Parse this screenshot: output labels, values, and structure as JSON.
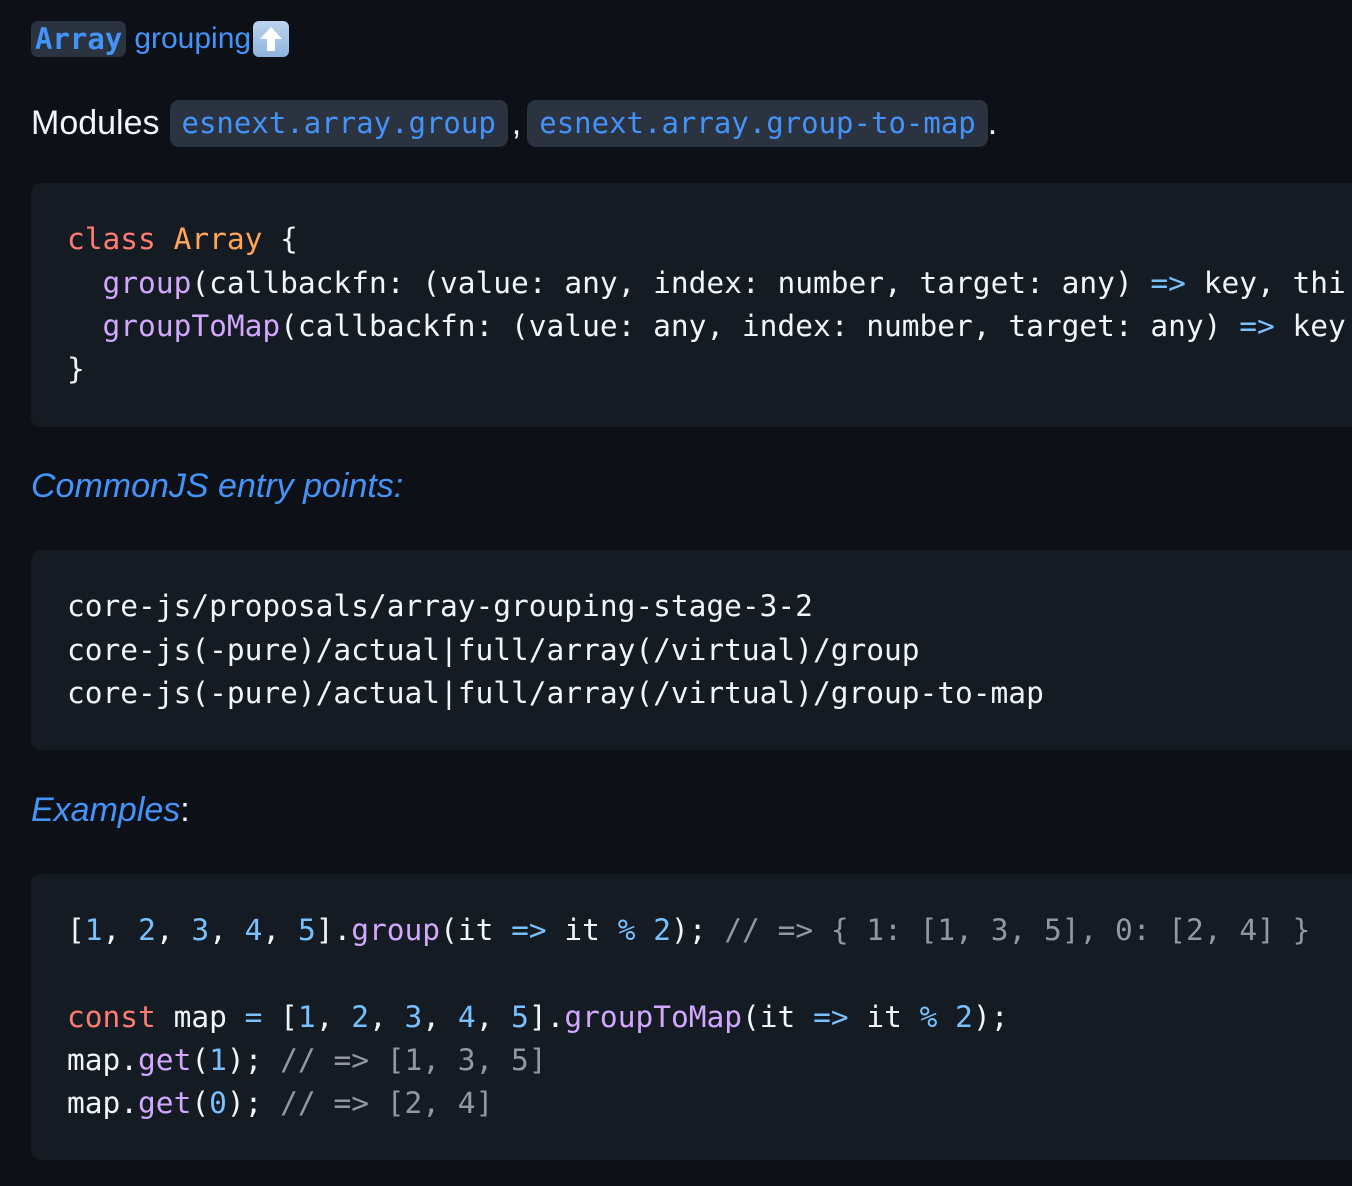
{
  "heading": {
    "code": "Array",
    "text": "grouping",
    "icon": "up-arrow-emoji-icon"
  },
  "modules": {
    "prefix": "Modules",
    "items": [
      "esnext.array.group",
      "esnext.array.group-to-map"
    ],
    "separator": ",",
    "suffix": "."
  },
  "type_def": {
    "lines": [
      [
        {
          "t": "class",
          "c": "kw"
        },
        {
          "t": " ",
          "c": ""
        },
        {
          "t": "Array",
          "c": "cls"
        },
        {
          "t": " {",
          "c": ""
        }
      ],
      [
        {
          "t": "  ",
          "c": ""
        },
        {
          "t": "group",
          "c": "fn"
        },
        {
          "t": "(callbackfn: (value: any, index: number, target: any) ",
          "c": ""
        },
        {
          "t": "=>",
          "c": "op"
        },
        {
          "t": " key, thi",
          "c": ""
        }
      ],
      [
        {
          "t": "  ",
          "c": ""
        },
        {
          "t": "groupToMap",
          "c": "fn"
        },
        {
          "t": "(callbackfn: (value: any, index: number, target: any) ",
          "c": ""
        },
        {
          "t": "=>",
          "c": "op"
        },
        {
          "t": " key",
          "c": ""
        }
      ],
      [
        {
          "t": "}",
          "c": ""
        }
      ]
    ]
  },
  "entry_points": {
    "label": "CommonJS entry points:",
    "lines": [
      "core-js/proposals/array-grouping-stage-3-2",
      "core-js(-pure)/actual|full/array(/virtual)/group",
      "core-js(-pure)/actual|full/array(/virtual)/group-to-map"
    ]
  },
  "examples": {
    "label": "Examples",
    "colon": ":",
    "lines": [
      [
        {
          "t": "[",
          "c": ""
        },
        {
          "t": "1",
          "c": "num"
        },
        {
          "t": ", ",
          "c": ""
        },
        {
          "t": "2",
          "c": "num"
        },
        {
          "t": ", ",
          "c": ""
        },
        {
          "t": "3",
          "c": "num"
        },
        {
          "t": ", ",
          "c": ""
        },
        {
          "t": "4",
          "c": "num"
        },
        {
          "t": ", ",
          "c": ""
        },
        {
          "t": "5",
          "c": "num"
        },
        {
          "t": "].",
          "c": ""
        },
        {
          "t": "group",
          "c": "fn"
        },
        {
          "t": "(it ",
          "c": ""
        },
        {
          "t": "=>",
          "c": "op"
        },
        {
          "t": " it ",
          "c": ""
        },
        {
          "t": "%",
          "c": "op"
        },
        {
          "t": " ",
          "c": ""
        },
        {
          "t": "2",
          "c": "num"
        },
        {
          "t": "); ",
          "c": ""
        },
        {
          "t": "// => { 1: [1, 3, 5], 0: [2, 4] }",
          "c": "cm"
        }
      ],
      [],
      [
        {
          "t": "const",
          "c": "kw"
        },
        {
          "t": " map ",
          "c": ""
        },
        {
          "t": "=",
          "c": "op"
        },
        {
          "t": " [",
          "c": ""
        },
        {
          "t": "1",
          "c": "num"
        },
        {
          "t": ", ",
          "c": ""
        },
        {
          "t": "2",
          "c": "num"
        },
        {
          "t": ", ",
          "c": ""
        },
        {
          "t": "3",
          "c": "num"
        },
        {
          "t": ", ",
          "c": ""
        },
        {
          "t": "4",
          "c": "num"
        },
        {
          "t": ", ",
          "c": ""
        },
        {
          "t": "5",
          "c": "num"
        },
        {
          "t": "].",
          "c": ""
        },
        {
          "t": "groupToMap",
          "c": "fn"
        },
        {
          "t": "(it ",
          "c": ""
        },
        {
          "t": "=>",
          "c": "op"
        },
        {
          "t": " it ",
          "c": ""
        },
        {
          "t": "%",
          "c": "op"
        },
        {
          "t": " ",
          "c": ""
        },
        {
          "t": "2",
          "c": "num"
        },
        {
          "t": ");",
          "c": ""
        }
      ],
      [
        {
          "t": "map.",
          "c": ""
        },
        {
          "t": "get",
          "c": "fn"
        },
        {
          "t": "(",
          "c": ""
        },
        {
          "t": "1",
          "c": "num"
        },
        {
          "t": "); ",
          "c": ""
        },
        {
          "t": "// => [1, 3, 5]",
          "c": "cm"
        }
      ],
      [
        {
          "t": "map.",
          "c": ""
        },
        {
          "t": "get",
          "c": "fn"
        },
        {
          "t": "(",
          "c": ""
        },
        {
          "t": "0",
          "c": "num"
        },
        {
          "t": "); ",
          "c": ""
        },
        {
          "t": "// => [2, 4]",
          "c": "cm"
        }
      ]
    ]
  }
}
